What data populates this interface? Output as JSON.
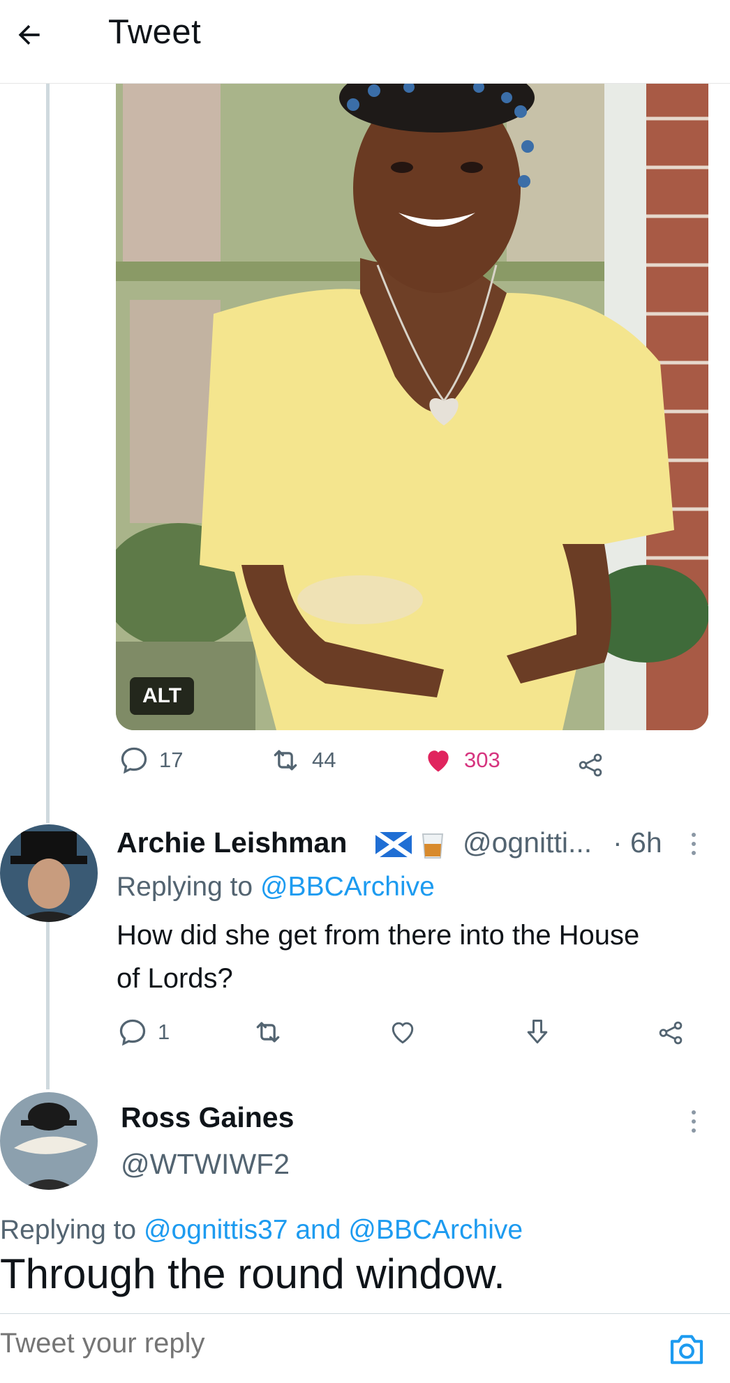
{
  "header": {
    "title": "Tweet",
    "back_icon": "arrow-left-icon"
  },
  "main_tweet": {
    "alt_label": "ALT",
    "stats": {
      "replies": "17",
      "retweets": "44",
      "likes": "303"
    },
    "like_color": "#d6347f"
  },
  "reply1": {
    "name": "Archie Leishman",
    "emojis": [
      "scotland-flag-icon",
      "whisky-glass-icon"
    ],
    "handle": "@ognitti...",
    "time": "· 6h",
    "replying_prefix": "Replying to",
    "replying_to": "@BBCArchive",
    "text": "How did she get from there into the House of Lords?",
    "stats": {
      "replies": "1"
    }
  },
  "reply2": {
    "name": "Ross Gaines",
    "handle": "@WTWIWF2",
    "replying_prefix": "Replying to",
    "replying_to": "@ognittis37 and @BBCArchive",
    "text": "Through the round window."
  },
  "composer": {
    "placeholder": "Tweet your reply"
  },
  "colors": {
    "accent": "#1d9bf0",
    "secondary_text": "#536471",
    "thread_line": "#cfd9de"
  }
}
